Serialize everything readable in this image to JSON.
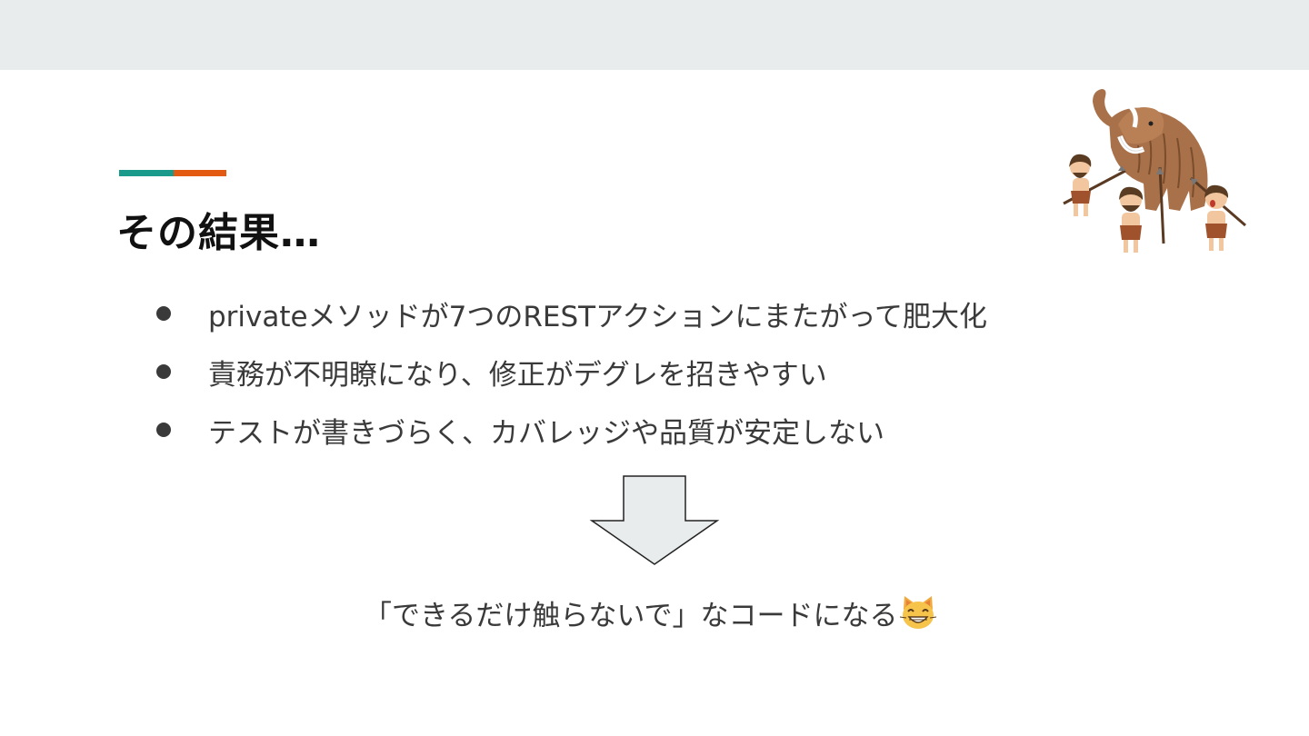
{
  "slide": {
    "title": "その結果…",
    "bullets": [
      "privateメソッドが7つのRESTアクションにまたがって肥大化",
      "責務が不明瞭になり、修正がデグレを招きやすい",
      "テストが書きづらく、カバレッジや品質が安定しない"
    ],
    "conclusion": "「できるだけ触らないで」なコードになる",
    "conclusion_emoji": "grinning-cat-icon",
    "arrow_icon": "down-arrow-icon",
    "illustration": "mammoth-hunting-cavemen-illustration"
  },
  "colors": {
    "accent_teal": "#1a9a8a",
    "accent_orange": "#e35b12",
    "top_band": "#e8ecec",
    "arrow_fill": "#e8ecec"
  }
}
